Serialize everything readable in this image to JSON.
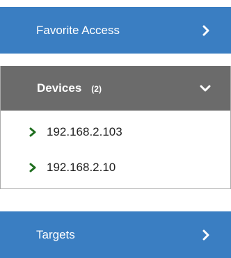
{
  "favorite_access": {
    "title": "Favorite Access",
    "icon": "chevron-right-icon",
    "color": "#3a7ec2"
  },
  "devices": {
    "title": "Devices",
    "count": "(2)",
    "icon": "chevron-down-icon",
    "color": "#6b6b6b",
    "items": [
      {
        "label": "192.168.2.103",
        "icon": "caret-right-icon"
      },
      {
        "label": "192.168.2.10",
        "icon": "caret-right-icon"
      }
    ],
    "item_icon_color": "#1f6e1f"
  },
  "targets": {
    "title": "Targets",
    "icon": "chevron-right-icon",
    "color": "#3a7ec2"
  }
}
